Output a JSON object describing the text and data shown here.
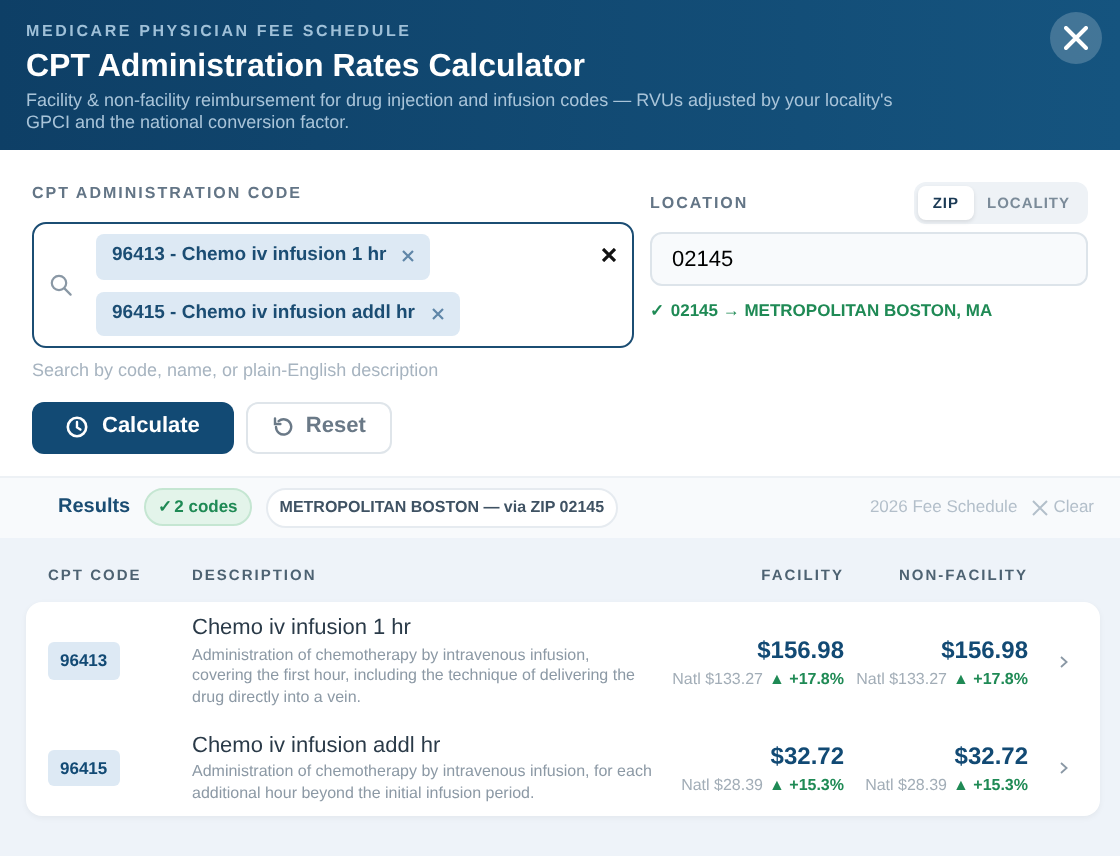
{
  "header": {
    "eyebrow": "MEDICARE PHYSICIAN FEE SCHEDULE",
    "title": "CPT Administration Rates Calculator",
    "subtitle": "Facility & non-facility reimbursement for drug injection and infusion codes — RVUs adjusted by your locality's GPCI and the national conversion factor."
  },
  "code_field": {
    "label": "CPT ADMINISTRATION CODE",
    "chips": [
      {
        "label": "96413 - Chemo iv infusion 1 hr"
      },
      {
        "label": "96415 - Chemo iv infusion addl hr"
      }
    ],
    "helper": "Search by code, name, or plain-English description"
  },
  "location": {
    "label": "LOCATION",
    "modes": [
      {
        "label": "ZIP",
        "selected": true
      },
      {
        "label": "LOCALITY",
        "selected": false
      }
    ],
    "value": "02145",
    "status": "✓ 02145 → METROPOLITAN BOSTON, MA"
  },
  "buttons": [
    {
      "label": "Calculate",
      "kind": "primary"
    },
    {
      "label": "Reset",
      "kind": "secondary"
    }
  ],
  "results": {
    "title": "Results",
    "count": "✓2 codes",
    "location": "METROPOLITAN BOSTON — via ZIP 02145",
    "schedule": "2026 Fee Schedule",
    "clear": "Clear"
  },
  "table": {
    "columns": [
      "CPT CODE",
      "DESCRIPTION",
      "FACILITY",
      "NON-FACILITY"
    ],
    "rows": [
      {
        "code": "96413",
        "name": "Chemo iv infusion 1 hr",
        "description": "Administration of chemotherapy by intravenous infusion, covering the first hour, including the technique of delivering the drug directly into a vein.",
        "facility": {
          "amount": "$156.98",
          "national": "Natl $133.27",
          "change": "▲ +17.8%"
        },
        "non_facility": {
          "amount": "$156.98",
          "national": "Natl $133.27",
          "change": "▲ +17.8%"
        }
      },
      {
        "code": "96415",
        "name": "Chemo iv infusion addl hr",
        "description": "Administration of chemotherapy by intravenous infusion, for each additional hour beyond the initial infusion period.",
        "facility": {
          "amount": "$32.72",
          "national": "Natl $28.39",
          "change": "▲ +15.3%"
        },
        "non_facility": {
          "amount": "$32.72",
          "national": "Natl $28.39",
          "change": "▲ +15.3%"
        }
      }
    ]
  }
}
